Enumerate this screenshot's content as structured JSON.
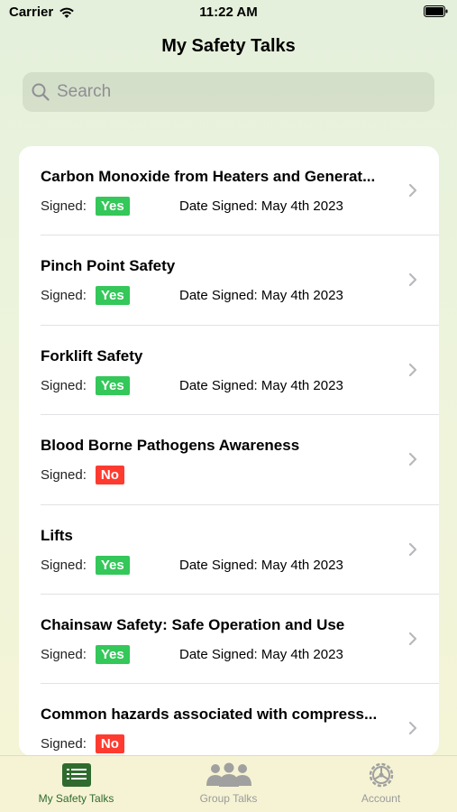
{
  "status_bar": {
    "carrier": "Carrier",
    "time": "11:22 AM"
  },
  "header": {
    "title": "My Safety Talks"
  },
  "search": {
    "placeholder": "Search"
  },
  "talks": [
    {
      "title": "Carbon Monoxide from Heaters and Generat...",
      "signed_label": "Signed:",
      "signed": "Yes",
      "date": "Date Signed: May 4th 2023"
    },
    {
      "title": "Pinch Point Safety",
      "signed_label": "Signed:",
      "signed": "Yes",
      "date": "Date Signed: May 4th 2023"
    },
    {
      "title": "Forklift Safety",
      "signed_label": "Signed:",
      "signed": "Yes",
      "date": "Date Signed: May 4th 2023"
    },
    {
      "title": "Blood Borne Pathogens Awareness",
      "signed_label": "Signed:",
      "signed": "No",
      "date": ""
    },
    {
      "title": "Lifts",
      "signed_label": "Signed:",
      "signed": "Yes",
      "date": "Date Signed: May 4th 2023"
    },
    {
      "title": "Chainsaw Safety: Safe Operation and Use",
      "signed_label": "Signed:",
      "signed": "Yes",
      "date": "Date Signed: May 4th 2023"
    },
    {
      "title": "Common hazards associated with compress...",
      "signed_label": "Signed:",
      "signed": "No",
      "date": ""
    }
  ],
  "tabbar": {
    "tabs": [
      {
        "label": "My Safety Talks",
        "icon": "list-icon",
        "active": true
      },
      {
        "label": "Group Talks",
        "icon": "group-icon",
        "active": false
      },
      {
        "label": "Account",
        "icon": "gear-icon",
        "active": false
      }
    ]
  },
  "colors": {
    "accent": "#2f6b2f",
    "yes": "#34c759",
    "no": "#ff3b30"
  }
}
